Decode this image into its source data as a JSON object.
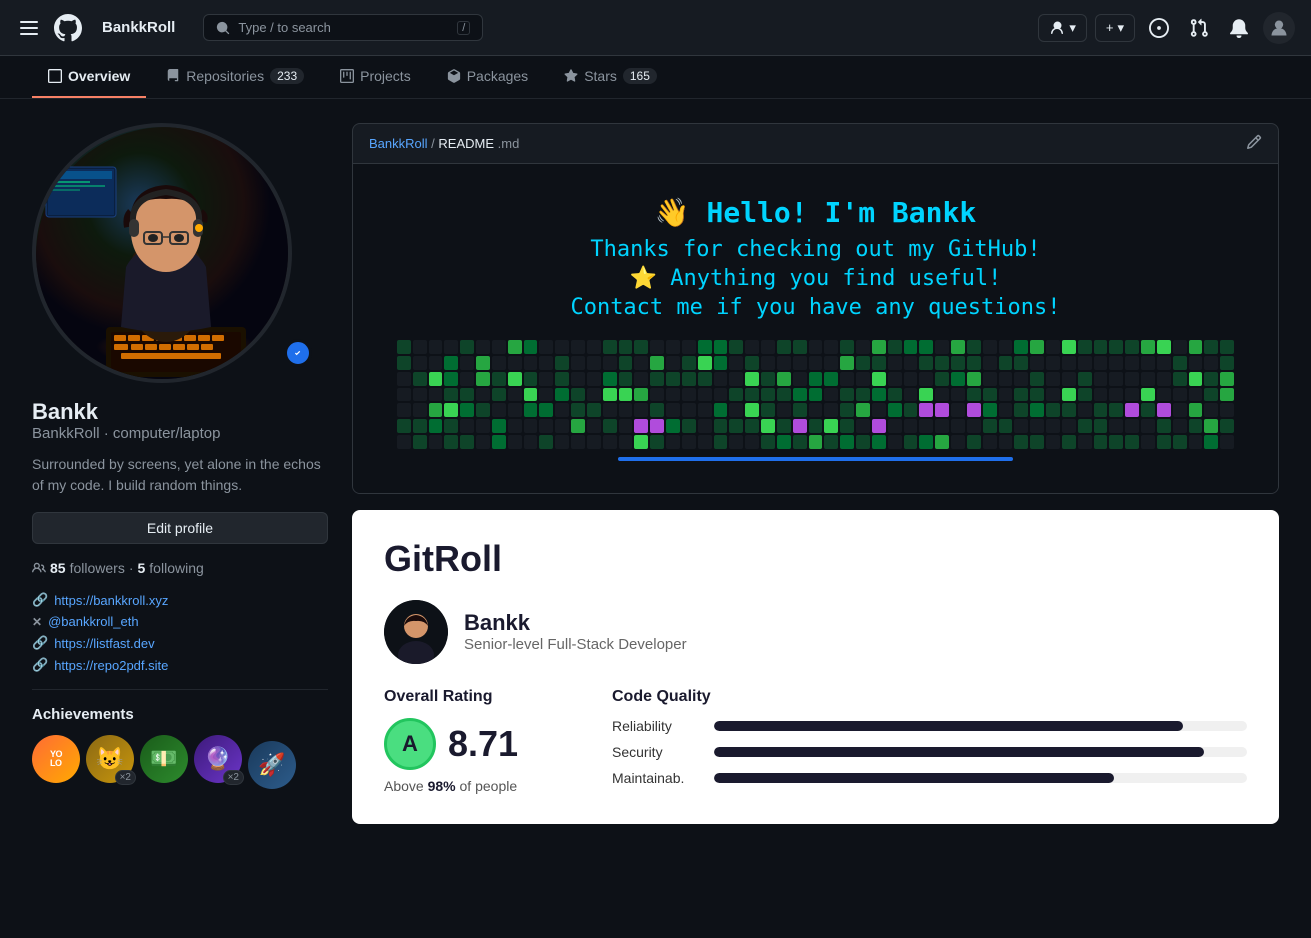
{
  "nav": {
    "hamburger_label": "☰",
    "logo_label": "GitHub",
    "site_name": "BankkRoll",
    "search_placeholder": "Type / to search",
    "search_slash": "/",
    "btn_add": "+",
    "btn_add_dropdown": "▾"
  },
  "tabs": [
    {
      "id": "overview",
      "label": "Overview",
      "active": true,
      "count": null,
      "icon": "📋"
    },
    {
      "id": "repositories",
      "label": "Repositories",
      "active": false,
      "count": "233",
      "icon": "📁"
    },
    {
      "id": "projects",
      "label": "Projects",
      "active": false,
      "count": null,
      "icon": "📊"
    },
    {
      "id": "packages",
      "label": "Packages",
      "active": false,
      "count": null,
      "icon": "📦"
    },
    {
      "id": "stars",
      "label": "Stars",
      "active": false,
      "count": "165",
      "icon": "⭐"
    }
  ],
  "profile": {
    "display_name": "Bankk",
    "handle": "BankkRoll",
    "handle_extra": "computer/laptop",
    "bio": "Surrounded by screens, yet alone in the echos of my code. I build random things.",
    "edit_profile_label": "Edit profile",
    "followers_count": "85",
    "followers_label": "followers",
    "following_count": "5",
    "following_label": "following",
    "links": [
      {
        "icon": "🔗",
        "text": "https://bankkroll.xyz",
        "url": "https://bankkroll.xyz"
      },
      {
        "icon": "✕",
        "text": "@bankkroll_eth",
        "url": "#"
      },
      {
        "icon": "🔗",
        "text": "https://listfast.dev",
        "url": "https://listfast.dev"
      },
      {
        "icon": "🔗",
        "text": "https://repo2pdf.site",
        "url": "https://repo2pdf.site"
      }
    ],
    "achievements_title": "Achievements",
    "achievements": [
      {
        "emoji": "🏅",
        "label": "YOLO",
        "count": null,
        "bg": "#ffb347",
        "text": "YOLO"
      },
      {
        "emoji": "😺",
        "label": "badge-2",
        "count": "×2",
        "bg": "#f4a460"
      },
      {
        "emoji": "💵",
        "label": "badge-3",
        "count": null,
        "bg": "#90ee90"
      },
      {
        "emoji": "🔮",
        "label": "badge-4",
        "count": "×2",
        "bg": "#9370db"
      }
    ]
  },
  "readme": {
    "breadcrumb_repo": "BankkRoll",
    "breadcrumb_sep": " / ",
    "breadcrumb_file": "README",
    "breadcrumb_ext": ".md",
    "greeting": "👋  Hello! I'm Bankk",
    "line2": "Thanks for checking out my GitHub!",
    "line3": "⭐  Anything you find useful!",
    "line4": "Contact me if you have any questions!"
  },
  "contribution_scrollbar_label": "",
  "gitroll": {
    "title": "GitRoll",
    "user_name": "Bankk",
    "user_role": "Senior-level Full-Stack Developer",
    "overall_rating_label": "Overall Rating",
    "grade": "A",
    "score": "8.71",
    "percentile_text": "Above",
    "percentile_bold": "98%",
    "percentile_suffix": "of people",
    "code_quality_label": "Code Quality",
    "quality_metrics": [
      {
        "name": "Reliability",
        "pct": 88
      },
      {
        "name": "Security",
        "pct": 92
      },
      {
        "name": "Maintainab.",
        "pct": 75
      }
    ]
  }
}
